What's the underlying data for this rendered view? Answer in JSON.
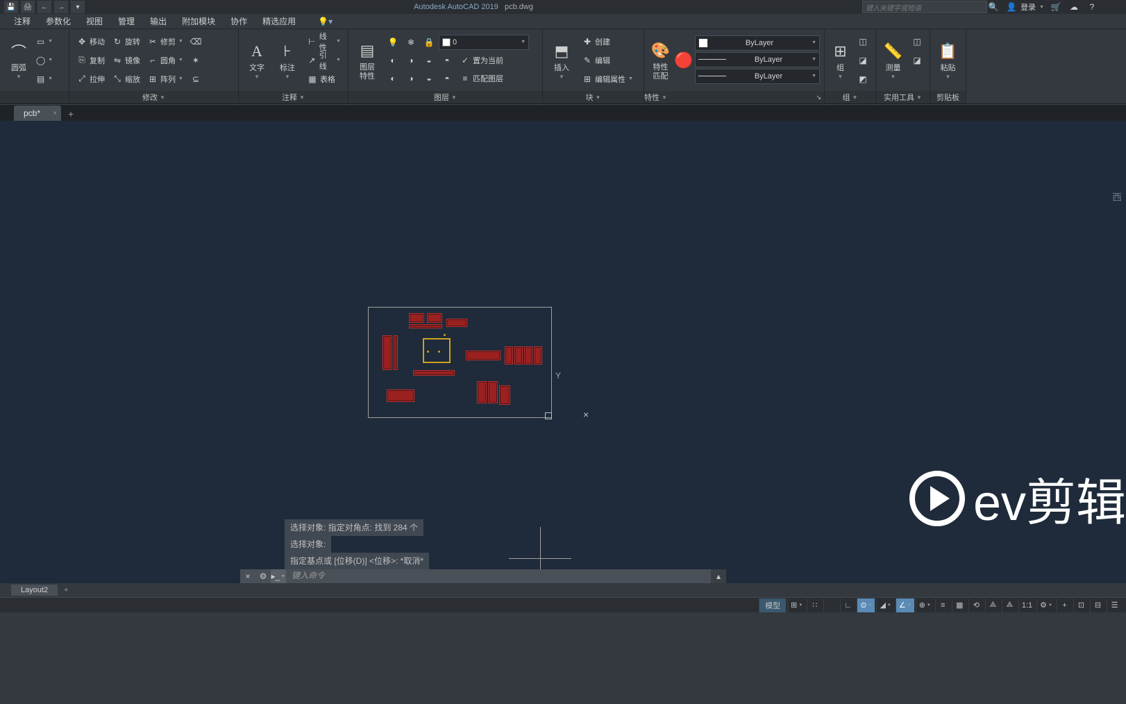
{
  "titlebar": {
    "app_name": "Autodesk AutoCAD 2019",
    "filename": "pcb.dwg",
    "search_placeholder": "键入关键字或短语",
    "login_label": "登录"
  },
  "menubar": {
    "items": [
      "注释",
      "参数化",
      "视图",
      "管理",
      "输出",
      "附加模块",
      "协作",
      "精选应用"
    ]
  },
  "ribbon": {
    "panels": {
      "draw": {
        "arc_label": "圆弧"
      },
      "modify": {
        "title": "修改",
        "move": "移动",
        "rotate": "旋转",
        "trim": "修剪",
        "copy": "复制",
        "mirror": "镜像",
        "fillet": "圆角",
        "stretch": "拉伸",
        "scale": "缩放",
        "array": "阵列"
      },
      "annotate": {
        "title": "注释",
        "text": "文字",
        "dimension": "标注",
        "linear": "线性",
        "leader": "引线",
        "table": "表格"
      },
      "layers": {
        "title": "图层",
        "big_label": "图层\n特性",
        "combo_value": "0",
        "make_current": "置为当前",
        "match": "匹配图层"
      },
      "block": {
        "title": "块",
        "insert": "插入",
        "create": "创建",
        "edit": "编辑",
        "edit_attr": "编辑属性"
      },
      "properties": {
        "title": "特性",
        "match": "特性\n匹配",
        "bylayer": "ByLayer"
      },
      "group": {
        "title": "组",
        "label": "组"
      },
      "utilities": {
        "title": "实用工具",
        "measure": "测量"
      },
      "clipboard": {
        "title": "剪贴板",
        "paste": "粘贴"
      }
    }
  },
  "filetabs": {
    "active": "pcb*"
  },
  "canvas": {
    "viewcube_face": "西",
    "axis_y": "Y"
  },
  "cmd_history": [
    "选择对象: 指定对角点: 找到  284  个",
    "选择对象:",
    "指定基点或 [位移(D)] <位移>:  *取消*"
  ],
  "cmd_input": {
    "placeholder": "键入命令"
  },
  "layout_tabs": {
    "active": "Layout2"
  },
  "statusbar": {
    "model_label": "模型",
    "scale": "1:1"
  },
  "watermark": {
    "brand": "ev剪辑"
  }
}
